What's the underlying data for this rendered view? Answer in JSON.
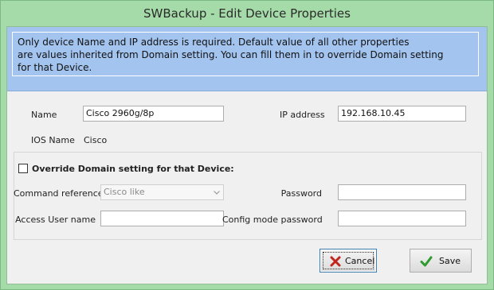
{
  "window": {
    "title": "SWBackup - Edit Device Properties"
  },
  "info": {
    "lines": [
      "Only device Name and IP address is required. Default value of all other properties",
      "are values inherited from Domain setting. You can fill them in to override Domain setting",
      "for that Device."
    ]
  },
  "device": {
    "name_label": "Name",
    "name_value": "Cisco 2960g/8p",
    "ip_label": "IP address",
    "ip_value": "192.168.10.45",
    "ios_label": "IOS Name",
    "ios_value": "Cisco"
  },
  "override": {
    "checkbox_label": "Override Domain setting for that Device:",
    "checked": false,
    "command_reference_label": "Command reference",
    "command_reference_value": "Cisco like",
    "password_label": "Password",
    "password_value": "",
    "access_user_label": "Access User name",
    "access_user_value": "",
    "config_password_label": "Config mode password",
    "config_password_value": ""
  },
  "buttons": {
    "cancel_label": "Cancel",
    "save_label": "Save"
  },
  "colors": {
    "frame": "#a5dba8",
    "info_background": "#a3c4ef",
    "cancel_icon": "#c0261c",
    "save_icon": "#2e9b2e"
  },
  "icons": {
    "cancel": "cross-icon",
    "save": "checkmark-icon",
    "dropdown": "chevron-down-icon"
  }
}
